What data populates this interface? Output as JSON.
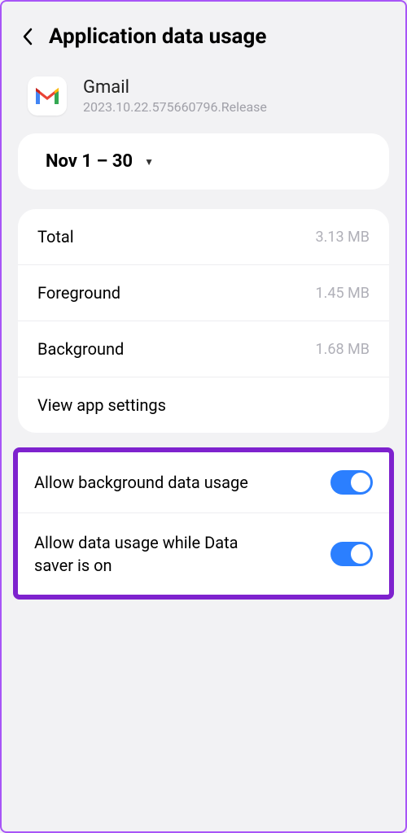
{
  "header": {
    "title": "Application data usage"
  },
  "app": {
    "name": "Gmail",
    "version": "2023.10.22.575660796.Release"
  },
  "period": {
    "label": "Nov 1 – 30"
  },
  "stats": {
    "total": {
      "label": "Total",
      "value": "3.13 MB"
    },
    "foreground": {
      "label": "Foreground",
      "value": "1.45 MB"
    },
    "background": {
      "label": "Background",
      "value": "1.68 MB"
    },
    "view_settings": "View app settings"
  },
  "toggles": {
    "allow_background": {
      "label": "Allow background data usage",
      "on": true
    },
    "allow_datasaver": {
      "label": "Allow data usage while Data saver is on",
      "on": true
    }
  }
}
